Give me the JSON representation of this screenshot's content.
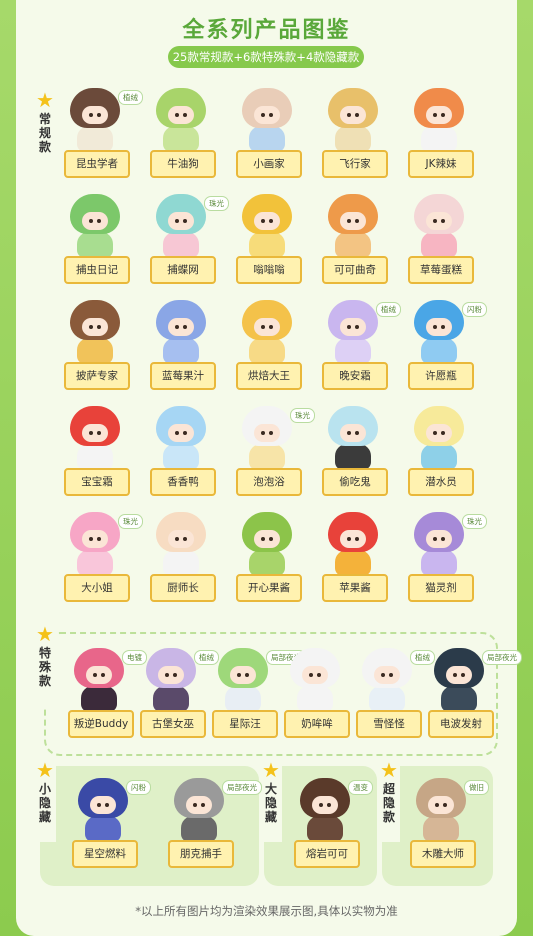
{
  "title": "全系列产品图鉴",
  "subtitle": "25款常规款+6款特殊款+4款隐藏款",
  "footnote": "*以上所有图片均为渲染效果展示图,具体以实物为准",
  "sections": {
    "regular": {
      "label": "常规款"
    },
    "special": {
      "label": "特殊款"
    },
    "hidden_small": {
      "label": "小隐藏"
    },
    "hidden_big": {
      "label": "大隐藏"
    },
    "hidden_super": {
      "label": "超隐款"
    }
  },
  "regular_items": [
    {
      "name": "昆虫学者",
      "badge": "植绒",
      "hood": "#6b4a3a",
      "body": "#f1ead8"
    },
    {
      "name": "牛油狗",
      "badge": "",
      "hood": "#a8d46a",
      "body": "#c9e59a"
    },
    {
      "name": "小画家",
      "badge": "",
      "hood": "#e9cdb8",
      "body": "#b8d5ef"
    },
    {
      "name": "飞行家",
      "badge": "",
      "hood": "#e8c06a",
      "body": "#efe0b5"
    },
    {
      "name": "JK辣妹",
      "badge": "",
      "hood": "#f08b4a",
      "body": "#f4f4f4"
    },
    {
      "name": "捕虫日记",
      "badge": "",
      "hood": "#7cc86a",
      "body": "#a8dd90"
    },
    {
      "name": "捕蝶网",
      "badge": "珠光",
      "hood": "#8fd8d2",
      "body": "#f7c7d4"
    },
    {
      "name": "嗡嗡嗡",
      "badge": "",
      "hood": "#f2c23a",
      "body": "#f7dc7a"
    },
    {
      "name": "可可曲奇",
      "badge": "",
      "hood": "#ee9a4a",
      "body": "#f3c483"
    },
    {
      "name": "草莓蛋糕",
      "badge": "",
      "hood": "#f4d6d6",
      "body": "#f7b5c2"
    },
    {
      "name": "披萨专家",
      "badge": "",
      "hood": "#8a5a3a",
      "body": "#f1c35a"
    },
    {
      "name": "蓝莓果汁",
      "badge": "",
      "hood": "#8aa6e6",
      "body": "#a6bff0"
    },
    {
      "name": "烘焙大王",
      "badge": "",
      "hood": "#f4c24a",
      "body": "#f7da86"
    },
    {
      "name": "晚安霜",
      "badge": "植绒",
      "hood": "#c9b6ef",
      "body": "#ddd0f5"
    },
    {
      "name": "许愿瓶",
      "badge": "闪粉",
      "hood": "#4aa6e6",
      "body": "#8fcbf2"
    },
    {
      "name": "宝宝霜",
      "badge": "",
      "hood": "#e8423a",
      "body": "#f4f4f4"
    },
    {
      "name": "香香鸭",
      "badge": "",
      "hood": "#a6d6f4",
      "body": "#c9e6f8"
    },
    {
      "name": "泡泡浴",
      "badge": "珠光",
      "hood": "#f4f4f4",
      "body": "#f7e4a8"
    },
    {
      "name": "偷吃鬼",
      "badge": "",
      "hood": "#b9e3ef",
      "body": "#3b3b3b"
    },
    {
      "name": "潜水员",
      "badge": "",
      "hood": "#f7ea9a",
      "body": "#8ed0e8"
    },
    {
      "name": "大小姐",
      "badge": "珠光",
      "hood": "#f7a6c6",
      "body": "#f9c6da"
    },
    {
      "name": "厨师长",
      "badge": "",
      "hood": "#f7dcc2",
      "body": "#f4f4f4"
    },
    {
      "name": "开心果酱",
      "badge": "",
      "hood": "#8cc44a",
      "body": "#a8d46a"
    },
    {
      "name": "苹果酱",
      "badge": "",
      "hood": "#e8423a",
      "body": "#f4b23a"
    },
    {
      "name": "猫灵剂",
      "badge": "珠光",
      "hood": "#a68ad8",
      "body": "#c9b6ef"
    }
  ],
  "special_items": [
    {
      "name": "叛逆Buddy",
      "badge": "电镀",
      "hood": "#e8668a",
      "body": "#3b2a3a"
    },
    {
      "name": "古堡女巫",
      "badge": "植绒",
      "hood": "#c9b6e6",
      "body": "#5a4a6a"
    },
    {
      "name": "星际汪",
      "badge": "局部夜光",
      "hood": "#9ed87a",
      "body": "#e8eef4"
    },
    {
      "name": "奶哞哞",
      "badge": "",
      "hood": "#f4f4f4",
      "body": "#f4f4f4"
    },
    {
      "name": "雪怪怪",
      "badge": "植绒",
      "hood": "#f4f4f4",
      "body": "#e8f0f6"
    },
    {
      "name": "电波发射",
      "badge": "局部夜光",
      "hood": "#2b3b4a",
      "body": "#3b4b5a"
    }
  ],
  "hidden_small_items": [
    {
      "name": "星空燃料",
      "badge": "闪粉",
      "hood": "#3a4aa6",
      "body": "#5a6ac6"
    },
    {
      "name": "朋克捕手",
      "badge": "局部夜光",
      "hood": "#9a9a9a",
      "body": "#6a6a6a"
    }
  ],
  "hidden_big_items": [
    {
      "name": "熔岩可可",
      "badge": "温变",
      "hood": "#5a3a2a",
      "body": "#6a4a3a"
    }
  ],
  "hidden_super_items": [
    {
      "name": "木雕大师",
      "badge": "做旧",
      "hood": "#c6a686",
      "body": "#d6b696"
    }
  ]
}
